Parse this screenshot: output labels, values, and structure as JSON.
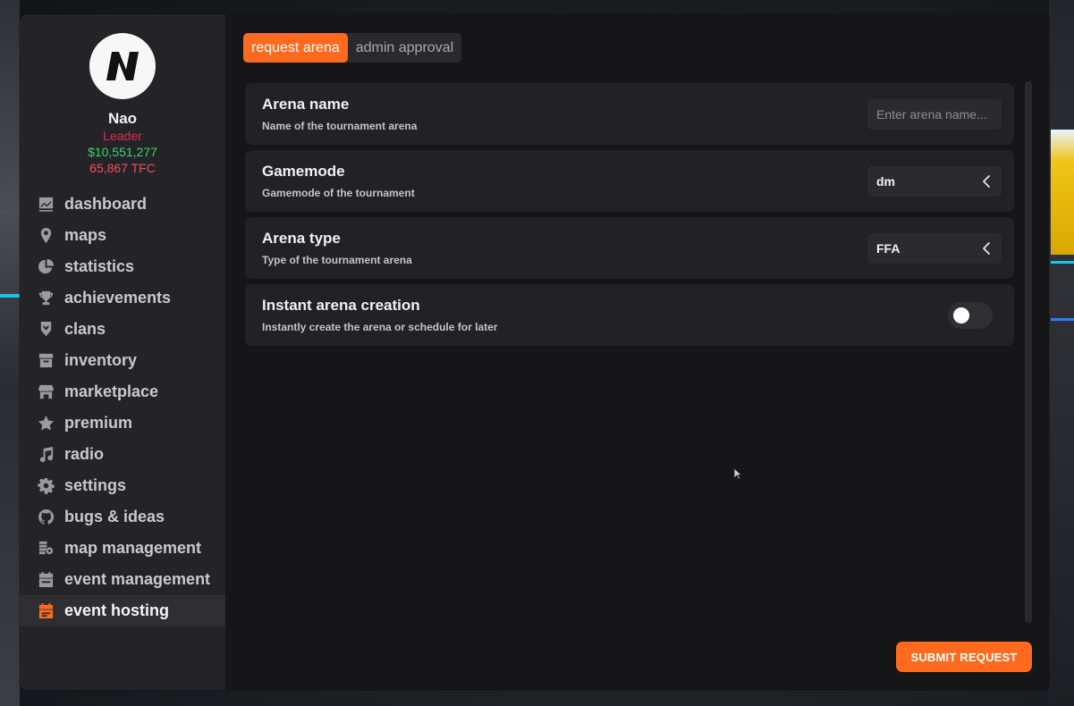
{
  "profile": {
    "logo_letter": "N",
    "name": "Nao",
    "role": "Leader",
    "money": "$10,551,277",
    "tfc": "65,867 TFC"
  },
  "nav": {
    "items": [
      {
        "label": "dashboard",
        "icon": "dashboard-icon"
      },
      {
        "label": "maps",
        "icon": "map-pin-icon"
      },
      {
        "label": "statistics",
        "icon": "pie-chart-icon"
      },
      {
        "label": "achievements",
        "icon": "trophy-icon"
      },
      {
        "label": "clans",
        "icon": "clan-badge-icon"
      },
      {
        "label": "inventory",
        "icon": "inventory-box-icon"
      },
      {
        "label": "marketplace",
        "icon": "store-icon"
      },
      {
        "label": "premium",
        "icon": "star-icon"
      },
      {
        "label": "radio",
        "icon": "music-note-icon"
      },
      {
        "label": "settings",
        "icon": "gear-icon"
      },
      {
        "label": "bugs & ideas",
        "icon": "github-icon"
      },
      {
        "label": "map management",
        "icon": "map-management-icon"
      },
      {
        "label": "event management",
        "icon": "calendar-icon"
      },
      {
        "label": "event hosting",
        "icon": "event-hosting-icon"
      }
    ],
    "active_index": 13
  },
  "tabs": [
    {
      "label": "request arena",
      "active": true
    },
    {
      "label": "admin approval",
      "active": false
    }
  ],
  "form": {
    "arena_name": {
      "title": "Arena name",
      "description": "Name of the tournament arena",
      "value": "",
      "placeholder": "Enter arena name..."
    },
    "gamemode": {
      "title": "Gamemode",
      "description": "Gamemode of the tournament",
      "value": "dm"
    },
    "arena_type": {
      "title": "Arena type",
      "description": "Type of the tournament arena",
      "value": "FFA"
    },
    "instant_creation": {
      "title": "Instant arena creation",
      "description": "Instantly create the arena or schedule for later",
      "enabled": false
    }
  },
  "submit_label": "SUBMIT REQUEST",
  "colors": {
    "accent": "#ff6a1f",
    "role": "#e8284a",
    "money": "#3fd16a",
    "tfc": "#ef4f5f",
    "sidebar_bg": "#242428",
    "main_bg": "#161618"
  }
}
